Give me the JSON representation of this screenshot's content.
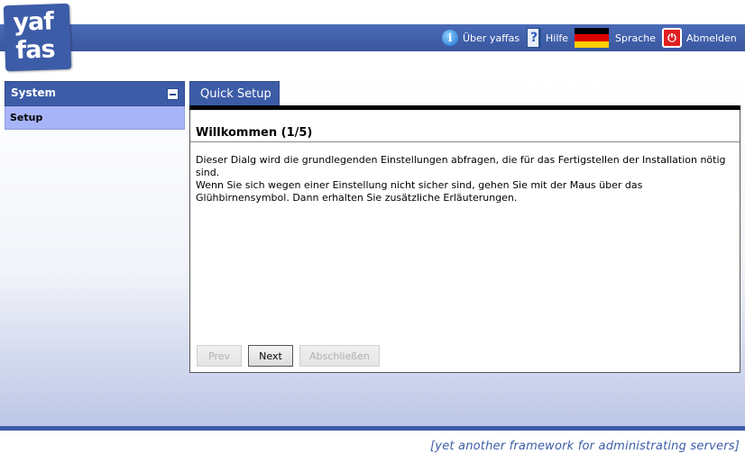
{
  "logo": {
    "line1": "yaf",
    "line2": "fas"
  },
  "header": {
    "about": "Über yaffas",
    "help": "Hilfe",
    "help_glyph": "?",
    "info_glyph": "i",
    "language": "Sprache",
    "logout": "Abmelden",
    "flag_colors": [
      "#000000",
      "#dd0000",
      "#ffce00"
    ],
    "accent": "#3d5ca8"
  },
  "sidebar": {
    "section_title": "System",
    "items": [
      {
        "label": "Setup"
      }
    ]
  },
  "main": {
    "tab": "Quick Setup",
    "heading": "Willkommen (1/5)",
    "paragraph_1": "Dieser Dialg wird die grundlegenden Einstellungen abfragen, die für das Fertigstellen der Installation nötig sind.",
    "paragraph_2": "Wenn Sie sich wegen einer Einstellung nicht sicher sind, gehen Sie mit der Maus über das Glühbirnensymbol. Dann erhalten Sie zusätzliche Erläuterungen.",
    "buttons": {
      "prev": "Prev",
      "next": "Next",
      "finish": "Abschließen"
    }
  },
  "footer": {
    "tagline": "[yet another framework for administrating servers]"
  }
}
